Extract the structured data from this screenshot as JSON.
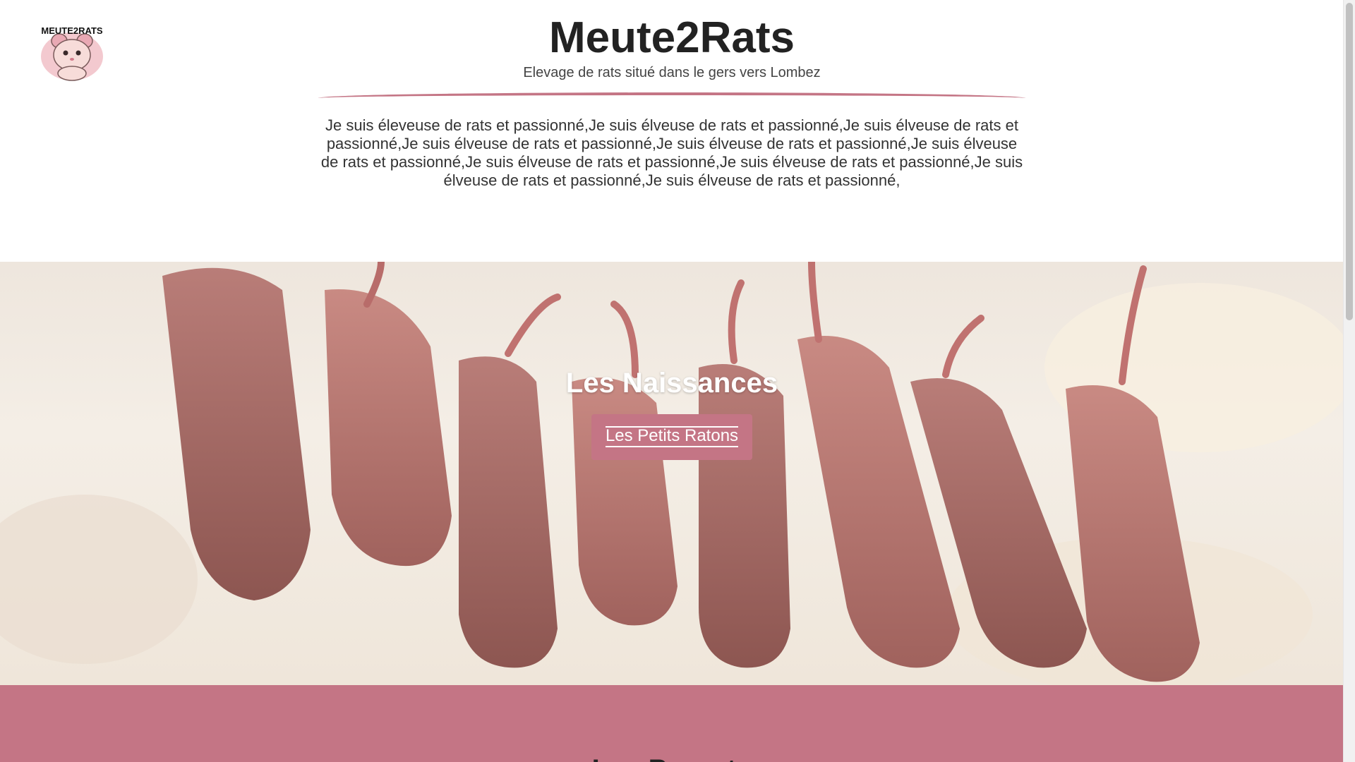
{
  "header": {
    "logo_alt_text": "MEUTE2RATS",
    "title": "Meute2Rats",
    "subtitle": "Elevage de rats situé dans le gers vers Lombez"
  },
  "intro": {
    "text": "Je suis éleveuse de rats et passionné,Je suis élveuse de rats et passionné,Je suis élveuse de rats et passionné,Je suis élveuse de rats et passionné,Je suis élveuse de rats et passionné,Je suis élveuse de rats et passionné,Je suis élveuse de rats et passionné,Je suis élveuse de rats et passionné,Je suis élveuse de rats et passionné,Je suis élveuse de rats et passionné,"
  },
  "hero": {
    "title": "Les Naissances",
    "button_label": "Les Petits Ratons"
  },
  "next_section": {
    "title": "Les Parents"
  },
  "colors": {
    "accent": "#c47585",
    "text": "#333333"
  }
}
